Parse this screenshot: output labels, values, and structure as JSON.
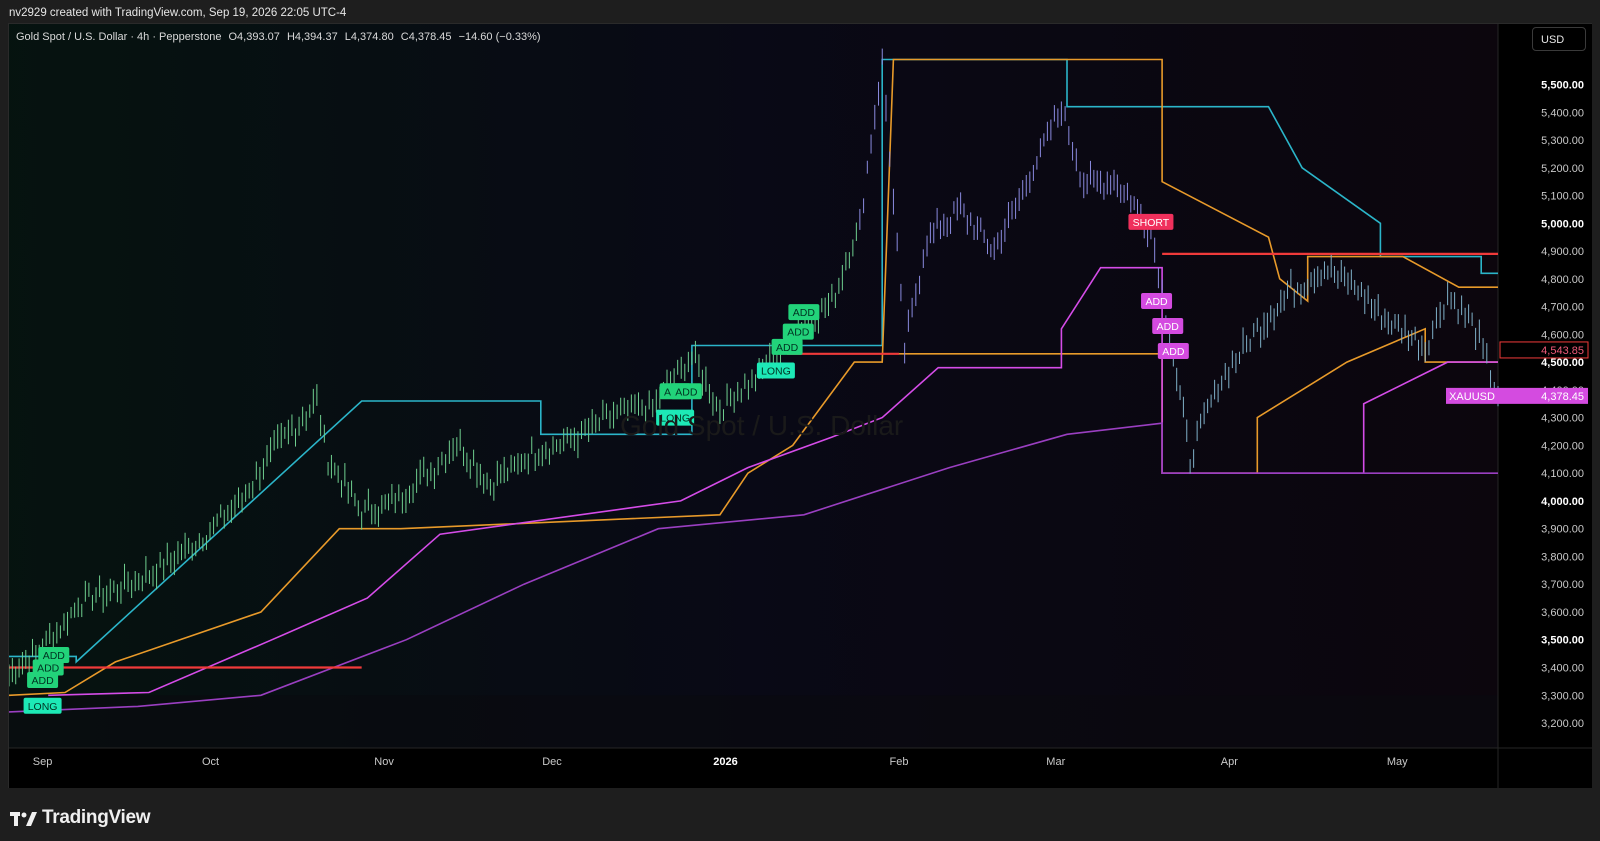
{
  "header": {
    "credit": "nv2929 created with TradingView.com, Sep 19, 2026 22:05 UTC-4"
  },
  "legend": {
    "symbol": "Gold Spot / U.S. Dollar · 4h · Pepperstone",
    "open": "O4,393.07",
    "high": "H4,394.37",
    "low": "L4,374.80",
    "close": "C4,378.45",
    "change": "−14.60 (−0.33%)"
  },
  "currency_button": "USD",
  "watermark": "Gold Spot / U.S. Dollar",
  "footer": {
    "brand": "TradingView"
  },
  "colors": {
    "background": "#000000",
    "candles": "#7fbf7f",
    "cyan_band": "#2bb5c9",
    "orange_band": "#e89a2a",
    "magenta_band": "#d54ce8",
    "purple_band": "#9a3fc1",
    "red_level": "#f03a3a",
    "long_label": "#1de9b6",
    "add_green": "#22d37a",
    "add_magenta": "#d44be0",
    "short_label": "#f0305c",
    "axis_text": "#c9c9c9"
  },
  "chart_data": {
    "type": "line",
    "title": "Gold Spot / U.S. Dollar · 4h · Pepperstone",
    "y_axis": {
      "ticks": [
        3200,
        3300,
        3400,
        3500,
        3600,
        3700,
        3800,
        3900,
        4000,
        4100,
        4200,
        4300,
        4400,
        4500,
        4600,
        4700,
        4800,
        4900,
        5000,
        5100,
        5200,
        5300,
        5400,
        5500
      ],
      "tick_labels": [
        "3,200.00",
        "3,300.00",
        "3,400.00",
        "3,500.00",
        "3,600.00",
        "3,700.00",
        "3,800.00",
        "3,900.00",
        "4,000.00",
        "4,100.00",
        "4,200.00",
        "4,300.00",
        "4,400.00",
        "4,500.00",
        "4,600.00",
        "4,700.00",
        "4,800.00",
        "4,900.00",
        "5,000.00",
        "5,100.00",
        "5,200.00",
        "5,300.00",
        "5,400.00",
        "5,500.00"
      ],
      "bold_labels": [
        "3,500.00",
        "4,000.00",
        "4,500.00",
        "5,000.00",
        "5,500.00"
      ],
      "range": [
        3110,
        5700
      ]
    },
    "x_axis": {
      "labels": [
        "Sep",
        "Oct",
        "Nov",
        "Dec",
        "2026",
        "Feb",
        "Mar",
        "Apr",
        "May"
      ],
      "bold_labels": [
        "2026"
      ],
      "range": [
        "2025-08-26",
        "2026-05-19"
      ]
    },
    "price_labels": [
      {
        "text": "4,543.85",
        "value": 4543.85,
        "style": "outline"
      },
      {
        "name": "XAUUSD",
        "text": "4,378.45",
        "value": 4378.45,
        "style": "filled"
      }
    ],
    "close_series": [
      {
        "date": "2025-08-26",
        "value": 3380
      },
      {
        "date": "2025-09-01",
        "value": 3470
      },
      {
        "date": "2025-09-08",
        "value": 3640
      },
      {
        "date": "2025-09-15",
        "value": 3690
      },
      {
        "date": "2025-09-22",
        "value": 3760
      },
      {
        "date": "2025-09-29",
        "value": 3860
      },
      {
        "date": "2025-10-06",
        "value": 3990
      },
      {
        "date": "2025-10-13",
        "value": 4200
      },
      {
        "date": "2025-10-20",
        "value": 4360
      },
      {
        "date": "2025-10-22",
        "value": 4150
      },
      {
        "date": "2025-10-28",
        "value": 3960
      },
      {
        "date": "2025-11-03",
        "value": 4000
      },
      {
        "date": "2025-11-10",
        "value": 4120
      },
      {
        "date": "2025-11-14",
        "value": 4220
      },
      {
        "date": "2025-11-20",
        "value": 4060
      },
      {
        "date": "2025-11-28",
        "value": 4180
      },
      {
        "date": "2025-12-05",
        "value": 4220
      },
      {
        "date": "2025-12-12",
        "value": 4310
      },
      {
        "date": "2025-12-19",
        "value": 4340
      },
      {
        "date": "2025-12-26",
        "value": 4520
      },
      {
        "date": "2025-12-31",
        "value": 4330
      },
      {
        "date": "2026-01-07",
        "value": 4460
      },
      {
        "date": "2026-01-14",
        "value": 4610
      },
      {
        "date": "2026-01-20",
        "value": 4720
      },
      {
        "date": "2026-01-25",
        "value": 5000
      },
      {
        "date": "2026-01-29",
        "value": 5590
      },
      {
        "date": "2026-02-02",
        "value": 4550
      },
      {
        "date": "2026-02-06",
        "value": 4950
      },
      {
        "date": "2026-02-12",
        "value": 5050
      },
      {
        "date": "2026-02-18",
        "value": 4900
      },
      {
        "date": "2026-02-25",
        "value": 5200
      },
      {
        "date": "2026-03-02",
        "value": 5420
      },
      {
        "date": "2026-03-06",
        "value": 5150
      },
      {
        "date": "2026-03-12",
        "value": 5150
      },
      {
        "date": "2026-03-18",
        "value": 4980
      },
      {
        "date": "2026-03-22",
        "value": 4520
      },
      {
        "date": "2026-03-25",
        "value": 4150
      },
      {
        "date": "2026-03-30",
        "value": 4420
      },
      {
        "date": "2026-04-06",
        "value": 4620
      },
      {
        "date": "2026-04-12",
        "value": 4760
      },
      {
        "date": "2026-04-18",
        "value": 4840
      },
      {
        "date": "2026-04-24",
        "value": 4760
      },
      {
        "date": "2026-04-30",
        "value": 4640
      },
      {
        "date": "2026-05-06",
        "value": 4560
      },
      {
        "date": "2026-05-10",
        "value": 4740
      },
      {
        "date": "2026-05-15",
        "value": 4620
      },
      {
        "date": "2026-05-19",
        "value": 4378.45
      }
    ],
    "bands": [
      {
        "key": "cyan",
        "points": [
          [
            "2025-08-26",
            3440
          ],
          [
            "2025-09-07",
            3440
          ],
          [
            "2025-09-07",
            3420
          ],
          [
            "2025-10-28",
            4360
          ],
          [
            "2025-11-29",
            4360
          ],
          [
            "2025-11-29",
            4240
          ],
          [
            "2025-12-26",
            4240
          ],
          [
            "2025-12-26",
            4560
          ],
          [
            "2026-01-29",
            4560
          ],
          [
            "2026-01-29",
            5590
          ],
          [
            "2026-03-03",
            5590
          ],
          [
            "2026-03-03",
            5420
          ],
          [
            "2026-04-08",
            5420
          ],
          [
            "2026-04-14",
            5200
          ],
          [
            "2026-04-28",
            5000
          ],
          [
            "2026-04-28",
            4880
          ],
          [
            "2026-05-16",
            4880
          ],
          [
            "2026-05-16",
            4820
          ],
          [
            "2026-05-19",
            4820
          ]
        ]
      },
      {
        "key": "orange",
        "points": [
          [
            "2025-08-26",
            3300
          ],
          [
            "2025-09-05",
            3310
          ],
          [
            "2025-09-14",
            3420
          ],
          [
            "2025-10-10",
            3600
          ],
          [
            "2025-10-24",
            3900
          ],
          [
            "2025-11-04",
            3900
          ],
          [
            "2025-12-31",
            3950
          ],
          [
            "2026-01-05",
            4100
          ],
          [
            "2026-01-13",
            4200
          ],
          [
            "2026-01-24",
            4500
          ],
          [
            "2026-01-29",
            4500
          ],
          [
            "2026-01-31",
            5590
          ],
          [
            "2026-03-20",
            5590
          ],
          [
            "2026-03-20",
            5150
          ],
          [
            "2026-04-08",
            4950
          ],
          [
            "2026-04-10",
            4800
          ],
          [
            "2026-04-15",
            4720
          ],
          [
            "2026-04-15",
            4880
          ],
          [
            "2026-05-02",
            4880
          ],
          [
            "2026-05-12",
            4770
          ],
          [
            "2026-05-19",
            4770
          ]
        ]
      },
      {
        "key": "orange2",
        "points": [
          [
            "2026-02-01",
            4530
          ],
          [
            "2026-03-20",
            4530
          ],
          [
            "2026-03-20",
            4100
          ],
          [
            "2026-04-06",
            4100
          ],
          [
            "2026-04-06",
            4300
          ],
          [
            "2026-04-22",
            4500
          ],
          [
            "2026-05-06",
            4620
          ],
          [
            "2026-05-06",
            4500
          ],
          [
            "2026-05-19",
            4500
          ]
        ]
      },
      {
        "key": "magenta",
        "points": [
          [
            "2025-09-02",
            3300
          ],
          [
            "2025-09-20",
            3310
          ],
          [
            "2025-10-12",
            3500
          ],
          [
            "2025-10-29",
            3650
          ],
          [
            "2025-11-11",
            3880
          ],
          [
            "2025-12-24",
            4000
          ],
          [
            "2026-01-05",
            4120
          ],
          [
            "2026-01-20",
            4230
          ],
          [
            "2026-01-29",
            4300
          ],
          [
            "2026-02-08",
            4480
          ],
          [
            "2026-03-02",
            4480
          ],
          [
            "2026-03-02",
            4620
          ],
          [
            "2026-03-09",
            4840
          ],
          [
            "2026-03-20",
            4840
          ],
          [
            "2026-03-20",
            4100
          ],
          [
            "2026-04-25",
            4100
          ],
          [
            "2026-04-25",
            4350
          ],
          [
            "2026-05-10",
            4500
          ],
          [
            "2026-05-19",
            4500
          ]
        ]
      },
      {
        "key": "purple",
        "points": [
          [
            "2025-08-26",
            3240
          ],
          [
            "2025-09-18",
            3260
          ],
          [
            "2025-10-10",
            3300
          ],
          [
            "2025-11-05",
            3500
          ],
          [
            "2025-11-26",
            3700
          ],
          [
            "2025-12-20",
            3900
          ],
          [
            "2026-01-15",
            3950
          ],
          [
            "2026-02-10",
            4120
          ],
          [
            "2026-03-03",
            4240
          ],
          [
            "2026-03-20",
            4280
          ],
          [
            "2026-03-20",
            4100
          ],
          [
            "2026-05-19",
            4100
          ]
        ]
      }
    ],
    "red_levels": [
      {
        "from": "2025-08-26",
        "to": "2025-10-28",
        "value": 3400
      },
      {
        "from": "2026-01-12",
        "to": "2026-02-01",
        "value": 4530
      },
      {
        "from": "2026-03-20",
        "to": "2026-05-19",
        "value": 4890
      }
    ],
    "signals": [
      {
        "text": "LONG",
        "date": "2025-09-01",
        "value": 3262,
        "kind": "long"
      },
      {
        "text": "ADD",
        "date": "2025-09-01",
        "value": 3355,
        "kind": "add"
      },
      {
        "text": "ADD",
        "date": "2025-09-02",
        "value": 3400,
        "kind": "add"
      },
      {
        "text": "ADD",
        "date": "2025-09-03",
        "value": 3445,
        "kind": "add"
      },
      {
        "text": "LONG",
        "date": "2025-12-23",
        "value": 4300,
        "kind": "long"
      },
      {
        "text": "ADD",
        "date": "2025-12-23",
        "value": 4395,
        "kind": "add"
      },
      {
        "text": "ADD",
        "date": "2025-12-25",
        "value": 4395,
        "kind": "add"
      },
      {
        "text": "LONG",
        "date": "2026-01-10",
        "value": 4470,
        "kind": "long"
      },
      {
        "text": "ADD",
        "date": "2026-01-12",
        "value": 4555,
        "kind": "add"
      },
      {
        "text": "ADD",
        "date": "2026-01-14",
        "value": 4610,
        "kind": "add"
      },
      {
        "text": "ADD",
        "date": "2026-01-15",
        "value": 4680,
        "kind": "add"
      },
      {
        "text": "SHORT",
        "date": "2026-03-18",
        "value": 5005,
        "kind": "short"
      },
      {
        "text": "ADD",
        "date": "2026-03-19",
        "value": 4720,
        "kind": "add_short"
      },
      {
        "text": "ADD",
        "date": "2026-03-21",
        "value": 4630,
        "kind": "add_short"
      },
      {
        "text": "ADD",
        "date": "2026-03-22",
        "value": 4540,
        "kind": "add_short"
      }
    ]
  }
}
